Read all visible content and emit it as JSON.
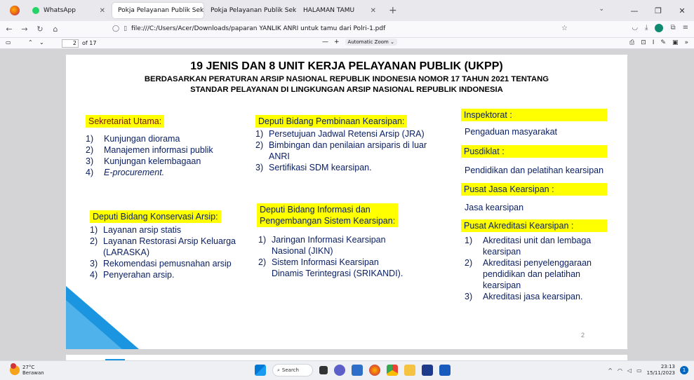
{
  "browser": {
    "tabs": [
      {
        "label": "WhatsApp"
      },
      {
        "label": "Pokja Pelayanan Publik Sekretariat"
      },
      {
        "label": "Pokja Pelayanan Publik Sekretariat"
      },
      {
        "label": "HALAMAN TAMU"
      }
    ],
    "url": "file:///C:/Users/Acer/Downloads/paparan YANLIK ANRI untuk tamu dari Polri-1.pdf"
  },
  "pdf_toolbar": {
    "page_current": "2",
    "page_total": "of 17",
    "zoom": "Automatic Zoom"
  },
  "slide": {
    "title": "19 JENIS DAN 8 UNIT KERJA PELAYANAN PUBLIK (UKPP)",
    "subtitle_line1": "BERDASARKAN PERATURAN ARSIP NASIONAL REPUBLIK INDONESIA NOMOR 17 TAHUN 2021 TENTANG",
    "subtitle_line2": "STANDAR PELAYANAN DI LINGKUNGAN ARSIP NASIONAL REPUBLIK INDONESIA",
    "sekretariat": {
      "heading": "Sekretariat Utama:",
      "items": [
        {
          "n": "1)",
          "text": "Kunjungan diorama"
        },
        {
          "n": "2)",
          "text": "Manajemen informasi publik"
        },
        {
          "n": "3)",
          "text": "Kunjungan kelembagaan"
        },
        {
          "n": "4)",
          "text": "E-procurement."
        }
      ]
    },
    "pembinaan": {
      "heading": "Deputi Bidang Pembinaan Kearsipan:",
      "items": [
        {
          "n": "1)",
          "text": "Persetujuan Jadwal Retensi Arsip (JRA)"
        },
        {
          "n": "2)",
          "text": "Bimbingan dan penilaian arsiparis di luar ANRI"
        },
        {
          "n": "3)",
          "text": "Sertifikasi SDM kearsipan."
        }
      ]
    },
    "konservasi": {
      "heading": "Deputi Bidang Konservasi Arsip:",
      "items": [
        {
          "n": "1)",
          "text": "Layanan arsip statis"
        },
        {
          "n": "2)",
          "text": "Layanan Restorasi Arsip Keluarga (LARASKA)"
        },
        {
          "n": "3)",
          "text": "Rekomendasi pemusnahan arsip"
        },
        {
          "n": "4)",
          "text": "Penyerahan arsip."
        }
      ]
    },
    "informasi": {
      "heading_line1": "Deputi Bidang Informasi dan",
      "heading_line2": "Pengembangan Sistem Kearsipan:",
      "items": [
        {
          "n": "1)",
          "text": "Jaringan Informasi Kearsipan Nasional (JIKN)"
        },
        {
          "n": "2)",
          "text": "Sistem Informasi Kearsipan Dinamis Terintegrasi (SRIKANDI)."
        }
      ]
    },
    "inspektorat": {
      "heading": "Inspektorat :",
      "text": "Pengaduan masyarakat"
    },
    "pusdiklat": {
      "heading": "Pusdiklat :",
      "text": "Pendidikan dan pelatihan kearsipan"
    },
    "jasa": {
      "heading": "Pusat Jasa Kearsipan :",
      "text": "Jasa kearsipan"
    },
    "akreditasi": {
      "heading": "Pusat Akreditasi Kearsipan :",
      "items": [
        {
          "n": "1)",
          "text": "Akreditasi unit dan lembaga kearsipan"
        },
        {
          "n": "2)",
          "text": "Akreditasi penyelenggaraan pendidikan dan pelatihan kearsipan"
        },
        {
          "n": "3)",
          "text": "Akreditasi jasa kearsipan."
        }
      ]
    },
    "page_number": "2"
  },
  "taskbar": {
    "temp": "27°C",
    "weather": "Berawan",
    "search": "Search",
    "time": "23:13",
    "date": "15/11/2023"
  },
  "colors": {
    "highlight": "#ffff00",
    "heading_red": "#7a1600",
    "body_blue": "#0c2166",
    "accent_blue": "#1b95e0"
  }
}
